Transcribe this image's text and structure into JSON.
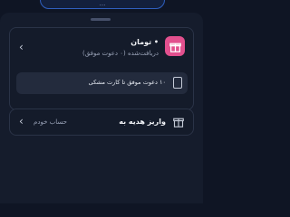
{
  "banner": {
    "text": "..."
  },
  "gift_card": {
    "amount": "• تومان",
    "received": "دریافت‌شده (۰ دعوت موفق)",
    "info_text": "۱۰ دعوت موفق تا کارت مشکی"
  },
  "gift_deposit": {
    "label": "واریز هدیه به",
    "account": "حساب خودم"
  },
  "icons": {
    "gift": "gift-icon",
    "card": "card-icon",
    "box": "gift-box-icon",
    "chevron": "chevron-left-icon"
  },
  "colors": {
    "background": "#0f1524",
    "sheet": "#151c2c",
    "gift_icon": "#e2508e",
    "info_row": "#232b3d"
  }
}
